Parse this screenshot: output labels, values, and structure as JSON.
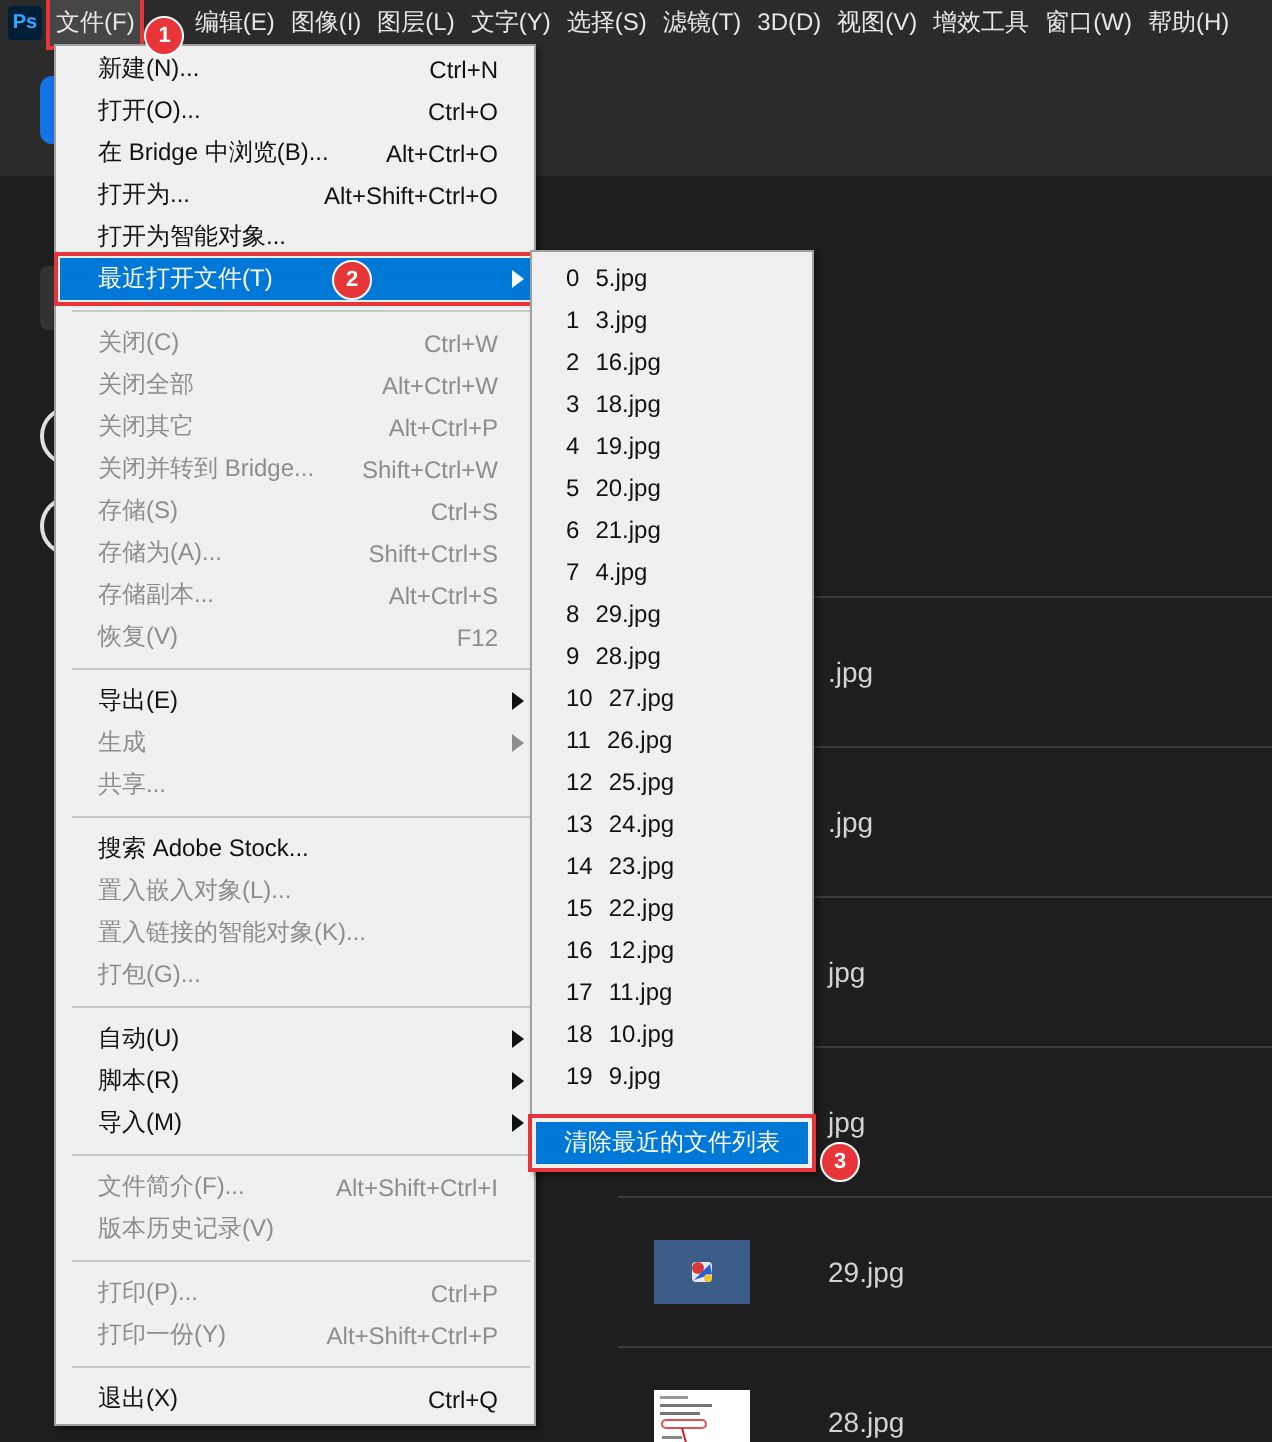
{
  "app_logo": "Ps",
  "menu_bar": [
    {
      "label": "文件(F)",
      "selected": true,
      "callout": "1"
    },
    {
      "label": "编辑(E)",
      "selected": false
    },
    {
      "label": "图像(I)",
      "selected": false
    },
    {
      "label": "图层(L)",
      "selected": false
    },
    {
      "label": "文字(Y)",
      "selected": false
    },
    {
      "label": "选择(S)",
      "selected": false
    },
    {
      "label": "滤镜(T)",
      "selected": false
    },
    {
      "label": "3D(D)",
      "selected": false
    },
    {
      "label": "视图(V)",
      "selected": false
    },
    {
      "label": "增效工具",
      "selected": false
    },
    {
      "label": "窗口(W)",
      "selected": false
    },
    {
      "label": "帮助(H)",
      "selected": false
    }
  ],
  "file_menu": {
    "items": [
      {
        "kind": "item",
        "label": "新建(N)...",
        "shortcut": "Ctrl+N",
        "disabled": false,
        "selected": false
      },
      {
        "kind": "item",
        "label": "打开(O)...",
        "shortcut": "Ctrl+O",
        "disabled": false,
        "selected": false
      },
      {
        "kind": "item",
        "label": "在 Bridge 中浏览(B)...",
        "shortcut": "Alt+Ctrl+O",
        "disabled": false,
        "selected": false
      },
      {
        "kind": "item",
        "label": "打开为...",
        "shortcut": "Alt+Shift+Ctrl+O",
        "disabled": false,
        "selected": false
      },
      {
        "kind": "item",
        "label": "打开为智能对象...",
        "disabled": false,
        "selected": false
      },
      {
        "kind": "item",
        "label": "最近打开文件(T)",
        "submenu": true,
        "disabled": false,
        "selected": true,
        "callout": "2"
      },
      {
        "kind": "separator"
      },
      {
        "kind": "item",
        "label": "关闭(C)",
        "shortcut": "Ctrl+W",
        "disabled": true,
        "selected": false
      },
      {
        "kind": "item",
        "label": "关闭全部",
        "shortcut": "Alt+Ctrl+W",
        "disabled": true,
        "selected": false
      },
      {
        "kind": "item",
        "label": "关闭其它",
        "shortcut": "Alt+Ctrl+P",
        "disabled": true,
        "selected": false
      },
      {
        "kind": "item",
        "label": "关闭并转到 Bridge...",
        "shortcut": "Shift+Ctrl+W",
        "disabled": true,
        "selected": false
      },
      {
        "kind": "item",
        "label": "存储(S)",
        "shortcut": "Ctrl+S",
        "disabled": true,
        "selected": false
      },
      {
        "kind": "item",
        "label": "存储为(A)...",
        "shortcut": "Shift+Ctrl+S",
        "disabled": true,
        "selected": false
      },
      {
        "kind": "item",
        "label": "存储副本...",
        "shortcut": "Alt+Ctrl+S",
        "disabled": true,
        "selected": false
      },
      {
        "kind": "item",
        "label": "恢复(V)",
        "shortcut": "F12",
        "disabled": true,
        "selected": false
      },
      {
        "kind": "separator"
      },
      {
        "kind": "item",
        "label": "导出(E)",
        "submenu": true,
        "disabled": false,
        "selected": false
      },
      {
        "kind": "item",
        "label": "生成",
        "submenu": true,
        "disabled": true,
        "selected": false
      },
      {
        "kind": "item",
        "label": "共享...",
        "disabled": true,
        "selected": false
      },
      {
        "kind": "separator"
      },
      {
        "kind": "item",
        "label": "搜索 Adobe Stock...",
        "disabled": false,
        "selected": false
      },
      {
        "kind": "item",
        "label": "置入嵌入对象(L)...",
        "disabled": true,
        "selected": false
      },
      {
        "kind": "item",
        "label": "置入链接的智能对象(K)...",
        "disabled": true,
        "selected": false
      },
      {
        "kind": "item",
        "label": "打包(G)...",
        "disabled": true,
        "selected": false
      },
      {
        "kind": "separator"
      },
      {
        "kind": "item",
        "label": "自动(U)",
        "submenu": true,
        "disabled": false,
        "selected": false
      },
      {
        "kind": "item",
        "label": "脚本(R)",
        "submenu": true,
        "disabled": false,
        "selected": false
      },
      {
        "kind": "item",
        "label": "导入(M)",
        "submenu": true,
        "disabled": false,
        "selected": false
      },
      {
        "kind": "separator"
      },
      {
        "kind": "item",
        "label": "文件简介(F)...",
        "shortcut": "Alt+Shift+Ctrl+I",
        "disabled": true,
        "selected": false
      },
      {
        "kind": "item",
        "label": "版本历史记录(V)",
        "disabled": true,
        "selected": false
      },
      {
        "kind": "separator"
      },
      {
        "kind": "item",
        "label": "打印(P)...",
        "shortcut": "Ctrl+P",
        "disabled": true,
        "selected": false
      },
      {
        "kind": "item",
        "label": "打印一份(Y)",
        "shortcut": "Alt+Shift+Ctrl+P",
        "disabled": true,
        "selected": false
      },
      {
        "kind": "separator"
      },
      {
        "kind": "item",
        "label": "退出(X)",
        "shortcut": "Ctrl+Q",
        "disabled": false,
        "selected": false
      }
    ]
  },
  "recent_submenu": {
    "items": [
      {
        "index": "0",
        "name": "5.jpg",
        "selected": false
      },
      {
        "index": "1",
        "name": "3.jpg",
        "selected": false
      },
      {
        "index": "2",
        "name": "16.jpg",
        "selected": false
      },
      {
        "index": "3",
        "name": "18.jpg",
        "selected": false
      },
      {
        "index": "4",
        "name": "19.jpg",
        "selected": false
      },
      {
        "index": "5",
        "name": "20.jpg",
        "selected": false
      },
      {
        "index": "6",
        "name": "21.jpg",
        "selected": false
      },
      {
        "index": "7",
        "name": "4.jpg",
        "selected": false
      },
      {
        "index": "8",
        "name": "29.jpg",
        "selected": false
      },
      {
        "index": "9",
        "name": "28.jpg",
        "selected": false
      },
      {
        "index": "10",
        "name": "27.jpg",
        "selected": false
      },
      {
        "index": "11",
        "name": "26.jpg",
        "selected": false
      },
      {
        "index": "12",
        "name": "25.jpg",
        "selected": false
      },
      {
        "index": "13",
        "name": "24.jpg",
        "selected": false
      },
      {
        "index": "14",
        "name": "23.jpg",
        "selected": false
      },
      {
        "index": "15",
        "name": "22.jpg",
        "selected": false
      },
      {
        "index": "16",
        "name": "12.jpg",
        "selected": false
      },
      {
        "index": "17",
        "name": "11.jpg",
        "selected": false
      },
      {
        "index": "18",
        "name": "10.jpg",
        "selected": false
      },
      {
        "index": "19",
        "name": "9.jpg",
        "selected": false
      }
    ],
    "clear": {
      "label": "清除最近的文件列表",
      "selected": true,
      "callout": "3"
    }
  },
  "recent_files": [
    {
      "name": ".jpg"
    },
    {
      "name": ".jpg"
    },
    {
      "name": "jpg"
    },
    {
      "name": "jpg"
    },
    {
      "name": "29.jpg"
    },
    {
      "name": "28.jpg"
    }
  ]
}
